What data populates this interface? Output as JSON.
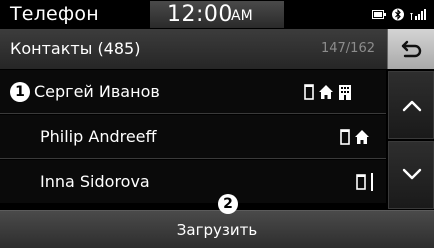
{
  "status_bar": {
    "app_title": "Телефон",
    "time": "12:00",
    "ampm": "AM",
    "icons": [
      "battery-icon",
      "bluetooth-icon",
      "signal-icon"
    ]
  },
  "header": {
    "title": "Контакты (485)",
    "page_count": "147/162",
    "back_icon": "back-arrow-icon"
  },
  "contacts": [
    {
      "marker": "1",
      "name": "Сергей Иванов",
      "icons": [
        "mobile-icon",
        "home-icon",
        "office-icon"
      ]
    },
    {
      "name": "Philip Andreeff",
      "icons": [
        "mobile-icon",
        "home-icon"
      ]
    },
    {
      "name": "Inna Sidorova",
      "icons": [
        "mobile-icon"
      ]
    }
  ],
  "scroll": {
    "up_icon": "chevron-up-icon",
    "down_icon": "chevron-down-icon"
  },
  "footer": {
    "marker": "2",
    "download_label": "Загрузить"
  }
}
